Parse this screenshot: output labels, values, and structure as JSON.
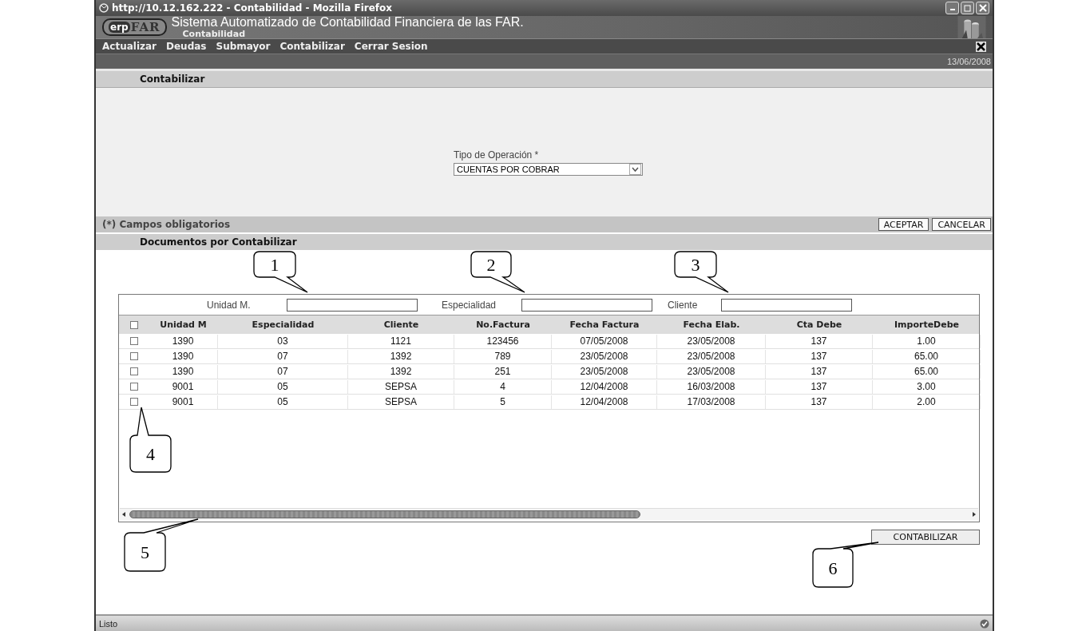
{
  "window": {
    "title": "http://10.12.162.222 - Contabilidad - Mozilla Firefox"
  },
  "header": {
    "logo_prefix": "erp",
    "logo_name": "FAR",
    "title": "Sistema Automatizado de Contabilidad Financiera de las FAR.",
    "subtitle": "Contabilidad"
  },
  "menu": [
    "Actualizar",
    "Deudas",
    "Submayor",
    "Contabilizar",
    "Cerrar Sesion"
  ],
  "date": "13/06/2008",
  "section_title": "Contabilizar",
  "form": {
    "label": "Tipo de Operación *",
    "value": "CUENTAS POR COBRAR"
  },
  "required_note": "(*) Campos obligatorios",
  "form_buttons": [
    "ACEPTAR",
    "CANCELAR"
  ],
  "documents_title": "Documentos por Contabilizar",
  "filters": [
    {
      "label": "Unidad M."
    },
    {
      "label": "Especialidad"
    },
    {
      "label": "Cliente"
    }
  ],
  "table": {
    "select_all_checked": false,
    "columns": [
      "Unidad M",
      "Especialidad",
      "Cliente",
      "No.Factura",
      "Fecha Factura",
      "Fecha Elab.",
      "Cta Debe",
      "ImporteDebe"
    ],
    "rows": [
      {
        "checked": false,
        "cells": [
          "1390",
          "03",
          "1121",
          "123456",
          "07/05/2008",
          "23/05/2008",
          "137",
          "1.00"
        ]
      },
      {
        "checked": false,
        "cells": [
          "1390",
          "07",
          "1392",
          "789",
          "23/05/2008",
          "23/05/2008",
          "137",
          "65.00"
        ]
      },
      {
        "checked": false,
        "cells": [
          "1390",
          "07",
          "1392",
          "251",
          "23/05/2008",
          "23/05/2008",
          "137",
          "65.00"
        ]
      },
      {
        "checked": false,
        "cells": [
          "9001",
          "05",
          "SEPSA",
          "4",
          "12/04/2008",
          "16/03/2008",
          "137",
          "3.00"
        ]
      },
      {
        "checked": false,
        "cells": [
          "9001",
          "05",
          "SEPSA",
          "5",
          "12/04/2008",
          "17/03/2008",
          "137",
          "2.00"
        ]
      }
    ]
  },
  "action_button": "CONTABILIZAR",
  "status": "Listo",
  "callouts": [
    "1",
    "2",
    "3",
    "4",
    "5",
    "6"
  ]
}
